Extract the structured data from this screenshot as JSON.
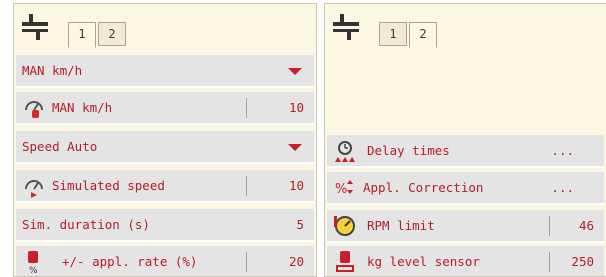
{
  "left": {
    "tabs": [
      {
        "label": "1",
        "active": true
      },
      {
        "label": "2",
        "active": false
      }
    ],
    "rows": [
      {
        "label": "MAN km/h",
        "type": "dropdown"
      },
      {
        "label": "MAN km/h",
        "value": "10",
        "icon": "hand-speed-icon"
      },
      {
        "label": "Speed Auto",
        "type": "dropdown"
      },
      {
        "label": "Simulated speed",
        "value": "10",
        "icon": "speedometer-icon"
      },
      {
        "label": "Sim. duration (s)",
        "value": "5"
      },
      {
        "label": "+/- appl. rate (%)",
        "value": "20",
        "icon": "bag-percent-icon"
      }
    ]
  },
  "right": {
    "tabs": [
      {
        "label": "1",
        "active": false
      },
      {
        "label": "2",
        "active": true
      }
    ],
    "rows": [
      {
        "label": "Delay times",
        "value": "...",
        "icon": "clock-icon"
      },
      {
        "label": "Appl. Correction",
        "value": "...",
        "icon": "percent-correction-icon"
      },
      {
        "label": "RPM limit",
        "value": "46",
        "icon": "gauge-icon"
      },
      {
        "label": "kg level sensor",
        "value": "250",
        "icon": "level-sensor-icon"
      }
    ]
  },
  "colors": {
    "text": "#b41e28",
    "panel": "#fcf7e3",
    "row": "#e4e4e4",
    "accent": "#c8202a"
  }
}
